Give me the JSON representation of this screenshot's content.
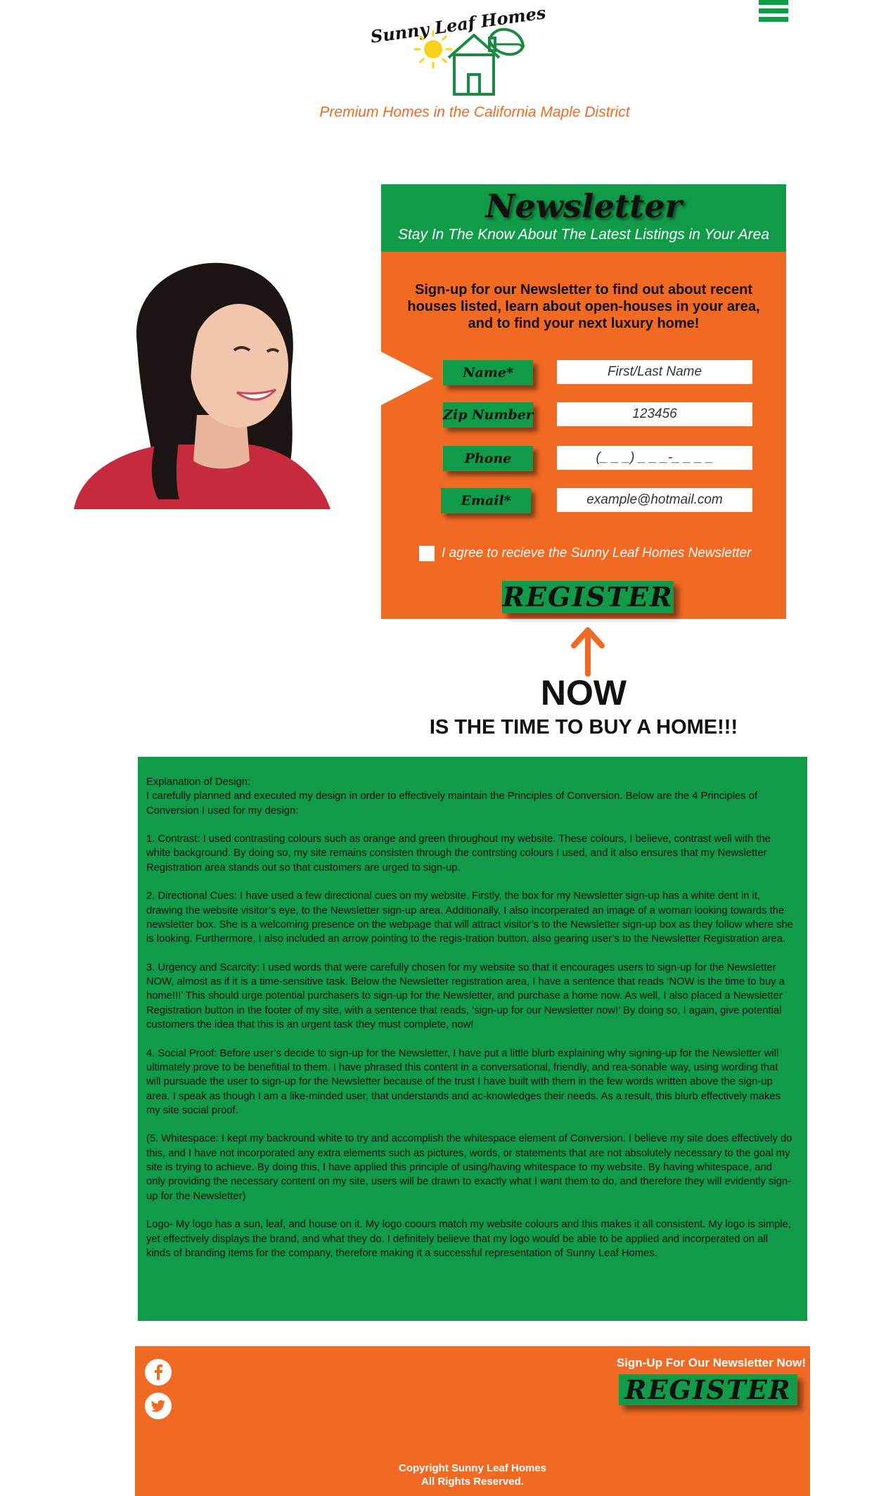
{
  "header": {
    "logo_text": "Sunny Leaf Homes",
    "tagline": "Premium Homes in the California Maple District",
    "menu_icon": "hamburger-menu-icon"
  },
  "newsletter": {
    "title": "Newsletter",
    "subtitle": "Stay In The Know About The Latest Listings in Your Area",
    "intro": "Sign-up for our Newsletter to find out about recent houses listed, learn about open-houses in your area, and to find your next luxury home!",
    "fields": [
      {
        "label": "Name*",
        "placeholder": "First/Last Name"
      },
      {
        "label": "Zip Number",
        "placeholder": "123456"
      },
      {
        "label": "Phone",
        "placeholder": "(_ _ _) _ _ _-_ _ _ _"
      },
      {
        "label": "Email*",
        "placeholder": "example@hotmail.com"
      }
    ],
    "agree_text": "I agree to recieve the Sunny Leaf Homes Newsletter",
    "register_label": "REGISTER"
  },
  "cta": {
    "now": "NOW",
    "time": "IS THE TIME TO BUY A HOME!!!"
  },
  "explanation": {
    "heading": "Explanation of Design:",
    "paragraphs": [
      "I carefully planned and executed my design in order to effectively maintain the Principles of Conversion. Below are the 4 Principles of Conversion I used for my design:",
      "1. Contrast: I used contrasting colours such as orange and green throughout my website. These colours, I believe, contrast well with the white background. By doing so, my site remains consisten through the contrsting colours I used, and it also ensures that my Newsletter Registration area stands out so that customers are urged to sign-up.",
      "2. Directional Cues: I have used a few directional cues on my website. Firstly, the box  for my Newsletter sign-up has a white dent in it, drawing the website visitor’s eye, to the Newsletter sign-up area. Additionally, I also incorperated an image of a woman looking towards the newsletter box. She is a welcoming presence on the webpage that will attract visitor’s to the Newsletter sign-up box as they follow where she is looking. Furthermore, I also included an arrow pointing to the regis-tration button, also gearing user’s to the Newsletter Registration area.",
      "3. Urgency and Scarcity: I used words that were carefully chosen for my website so that it encourages users to sign-up for the Newsletter NOW, almost as if it is a time-sensitive task. Below the Newsletter registration area, I have a sentence that reads ‘NOW is the time to buy a home!!!’ This should urge potential purchasers to sign-up for the Newsletter, and purchase a home now. As well, I also placed a Newsletter Registration button in the footer of my site, with a sentence that reads, ‘sign-up for our Newsletter now!’ By doing so, I again, give potential customers the idea that this is an urgent task they must complete, now!",
      "4. Social Proof: Before user’s decide to sign-up for the Newsletter, I have put a little blurb explaining why signing-up for the Newsletter will ultimately prove to be benefitial to them. I have phrased this content in a conversational, friendly, and rea-sonable way, using wording that will pursuade the user to sign-up for the Newsletter because of the trust I have built with them in the few words written above the sign-up area. I speak as though I am a like-minded user, that understands and ac-knowledges their needs. As a result, this blurb effectively makes my site social proof.",
      "(5. Whitespace: I kept my backround white to try and accomplish the whitespace element of Conversion. I believe my site does effectively do this, and I have not incorporated any extra elements such as pictures, words, or statements that are not absolutely necessary to the goal my site is trying to achieve. By doing this, I have applied this principle of using/having whitespace to my website. By having whitespace, and only providing the necessary content on my site, users will be drawn to exactly what I want them to do, and therefore they will evidently sign-up for the Newsletter)",
      "Logo- My logo has a sun, leaf, and house on it. My logo coours match my website colours and this makes it all consistent. My logo is simple, yet effectively displays the brand, and what they do. I definitely believe that my logo would be able to be applied and incorperated on all kinds of branding items for the company, therefore making it a successful representation of Sunny Leaf Homes."
    ]
  },
  "footer": {
    "social": [
      "facebook-icon",
      "twitter-icon"
    ],
    "cta_text": "Sign-Up For Our Newsletter Now!",
    "register_label": "REGISTER",
    "copyright_line1": "Copyright Sunny Leaf Homes",
    "copyright_line2": "All Rights Reserved."
  },
  "colors": {
    "green": "#119a47",
    "orange": "#f06a23",
    "background": "#ffffff"
  }
}
